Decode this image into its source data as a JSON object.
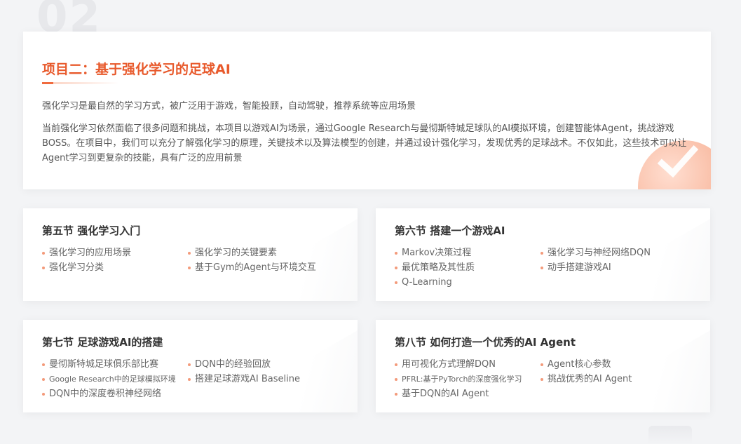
{
  "hero": {
    "title": "项目二：基于强化学习的足球AI",
    "paragraph1": "强化学习是最自然的学习方式，被广泛用于游戏，智能投顾，自动驾驶，推荐系统等应用场景",
    "paragraph2": "当前强化学习依然面临了很多问题和挑战，本项目以游戏AI为场景，通过Google   Research与曼彻斯特城足球队的AI模拟环境，创建智能体Agent，挑战游戏BOSS。在项目中，我们可以充分了解强化学习的原理，关键技术以及算法模型的创建，并通过设计强化学习，发现优秀的足球战术。不仅如此，这些技术可以让Agent学习到更复杂的技能，具有广泛的应用前景"
  },
  "sections": [
    {
      "title": "第五节  强化学习入门",
      "items": [
        "强化学习的应用场景",
        "强化学习的关键要素",
        "强化学习分类",
        "基于Gym的Agent与环境交互"
      ]
    },
    {
      "title": "第六节  搭建一个游戏AI",
      "items": [
        "Markov决策过程",
        "强化学习与神经网络DQN",
        "最优策略及其性质",
        "动手搭建游戏AI",
        "Q-Learning"
      ]
    },
    {
      "title": "第七节  足球游戏AI的搭建",
      "items": [
        "曼彻斯特城足球俱乐部比赛",
        "DQN中的经验回放",
        "Google Research中的足球模拟环境",
        "搭建足球游戏AI Baseline",
        "DQN中的深度卷积神经网络"
      ]
    },
    {
      "title": "第八节  如何打造一个优秀的AI Agent",
      "items": [
        "用可视化方式理解DQN",
        "Agent核心参数",
        "PFRL:基于PyTorch的深度强化学习",
        "挑战优秀的AI Agent",
        "基于DQN的AI Agent"
      ]
    }
  ],
  "colors": {
    "accent": "#e85a2c",
    "bullet": "#f39a7a"
  }
}
